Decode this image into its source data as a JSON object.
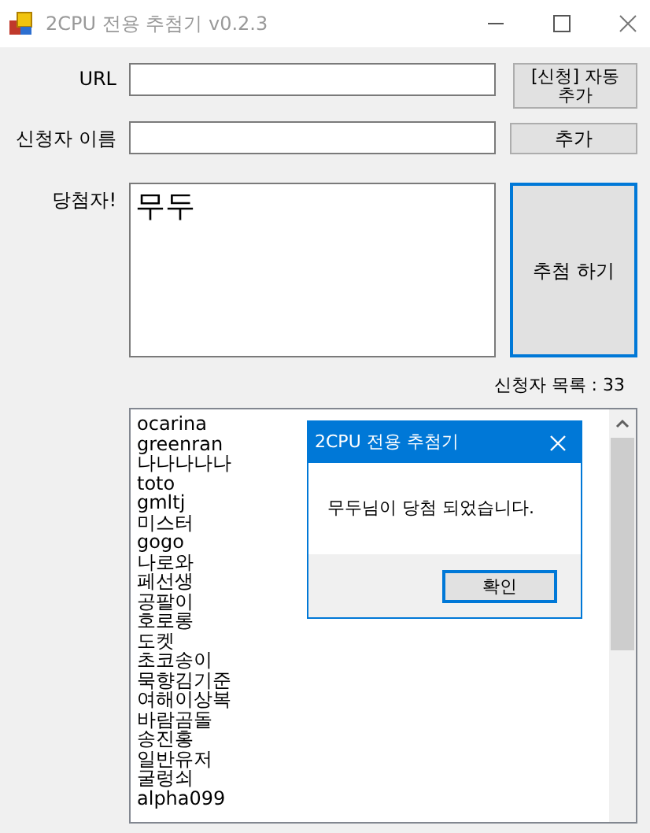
{
  "window": {
    "title": "2CPU 전용 추첨기 v0.2.3"
  },
  "url": {
    "label": "URL",
    "button": "[신청] 자동 추가"
  },
  "applicant": {
    "label": "신청자 이름",
    "button": "추가"
  },
  "winner": {
    "label": "당첨자!",
    "value": "무두",
    "button": "추첨 하기"
  },
  "list": {
    "count_label": "신청자 목록 : 33",
    "items": [
      "ocarina",
      "greenran",
      "나나나나나",
      "toto",
      "gmltj",
      "미스터",
      "gogo",
      "나로와",
      "페선생",
      "공팔이",
      "호로롱",
      "도켓",
      "초코송이",
      "묵향김기준",
      "여해이상복",
      "바람곰돌",
      "송진홍",
      "일반유저",
      "굴렁쇠",
      "alpha099"
    ]
  },
  "dialog": {
    "title": "2CPU 전용 추첨기",
    "message": "무두님이 당첨 되었습니다.",
    "button": "확인"
  }
}
